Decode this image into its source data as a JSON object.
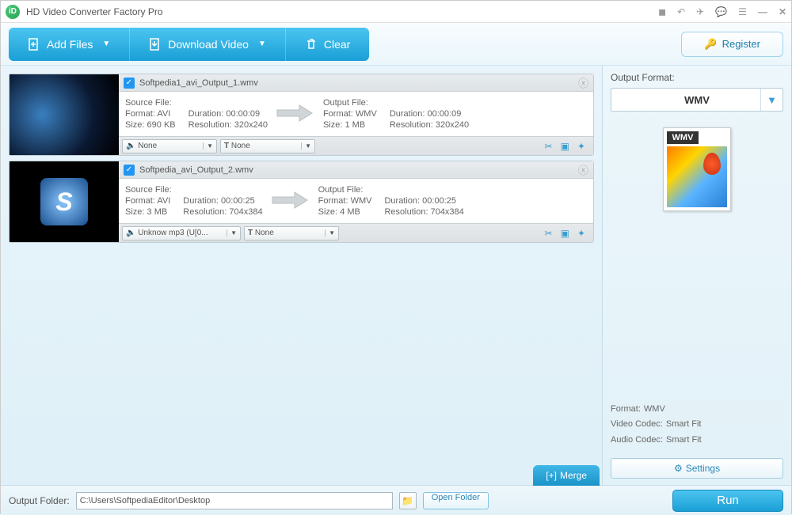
{
  "app": {
    "title": "HD Video Converter Factory Pro"
  },
  "toolbar": {
    "add_files": "Add Files",
    "download_video": "Download Video",
    "clear": "Clear",
    "register": "Register"
  },
  "files": [
    {
      "name": "Softpedia1_avi_Output_1.wmv",
      "source": {
        "label": "Source File:",
        "format_label": "Format:",
        "format": "AVI",
        "duration_label": "Duration:",
        "duration": "00:00:09",
        "size_label": "Size:",
        "size": "690 KB",
        "resolution_label": "Resolution:",
        "resolution": "320x240"
      },
      "output": {
        "label": "Output File:",
        "format_label": "Format:",
        "format": "WMV",
        "duration_label": "Duration:",
        "duration": "00:00:09",
        "size_label": "Size:",
        "size": "1 MB",
        "resolution_label": "Resolution:",
        "resolution": "320x240"
      },
      "audio_dd": "None",
      "sub_dd": "None"
    },
    {
      "name": "Softpedia_avi_Output_2.wmv",
      "source": {
        "label": "Source File:",
        "format_label": "Format:",
        "format": "AVI",
        "duration_label": "Duration:",
        "duration": "00:00:25",
        "size_label": "Size:",
        "size": "3 MB",
        "resolution_label": "Resolution:",
        "resolution": "704x384"
      },
      "output": {
        "label": "Output File:",
        "format_label": "Format:",
        "format": "WMV",
        "duration_label": "Duration:",
        "duration": "00:00:25",
        "size_label": "Size:",
        "size": "4 MB",
        "resolution_label": "Resolution:",
        "resolution": "704x384"
      },
      "audio_dd": "Unknow mp3 (U[0...",
      "sub_dd": "None"
    }
  ],
  "sidebar": {
    "title": "Output Format:",
    "selected": "WMV",
    "badge": "WMV",
    "info": {
      "format_label": "Format:",
      "format": "WMV",
      "vcodec_label": "Video Codec:",
      "vcodec": "Smart Fit",
      "acodec_label": "Audio Codec:",
      "acodec": "Smart Fit"
    },
    "settings": "Settings"
  },
  "bottom": {
    "output_folder_label": "Output Folder:",
    "output_folder": "C:\\Users\\SoftpediaEditor\\Desktop",
    "open_folder": "Open Folder",
    "merge": "Merge",
    "run": "Run"
  }
}
